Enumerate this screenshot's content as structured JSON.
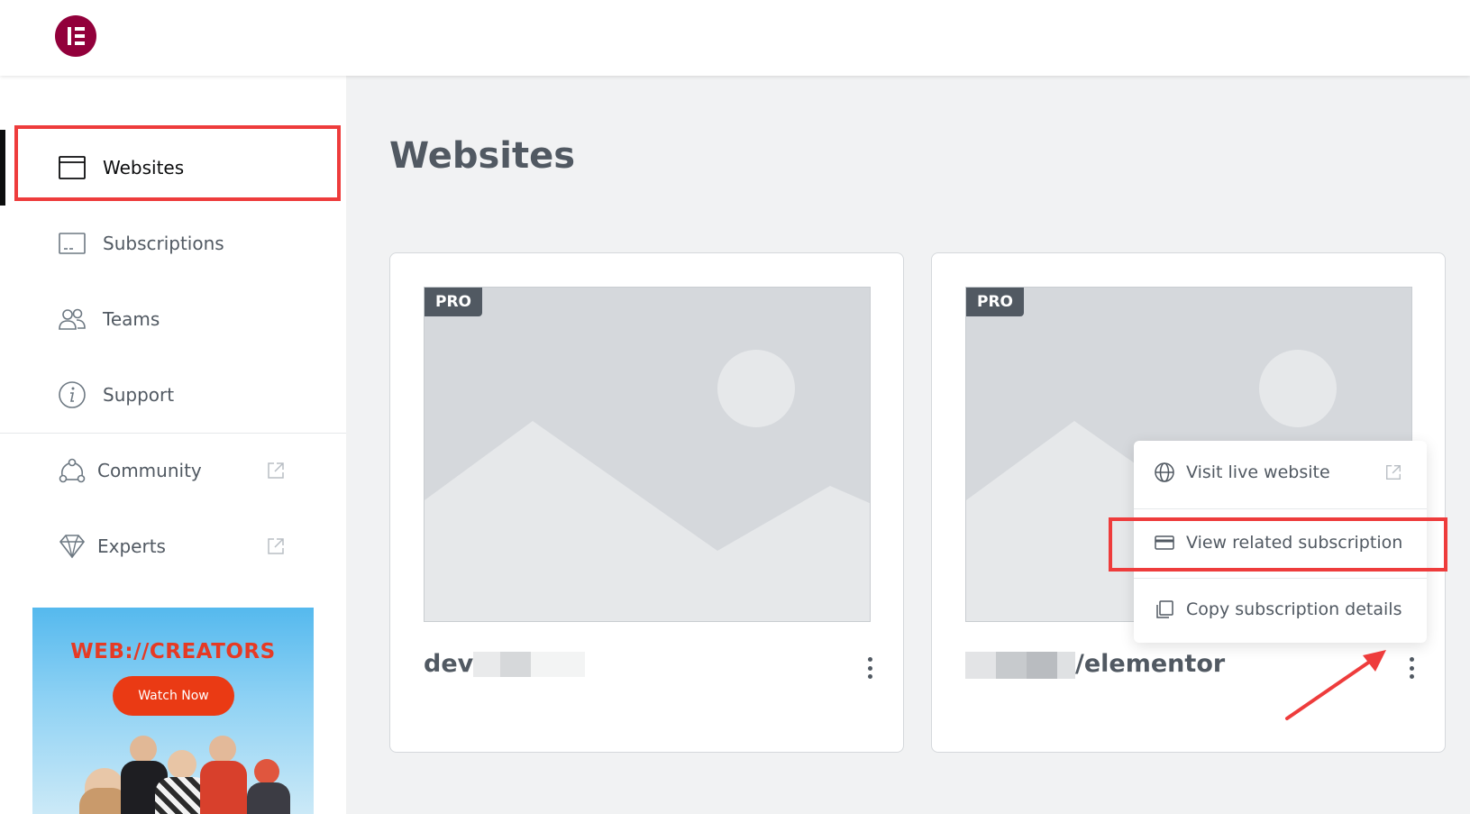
{
  "nav": {
    "items": [
      {
        "label": "Websites",
        "icon": "browser-window-icon",
        "active": true
      },
      {
        "label": "Subscriptions",
        "icon": "card-icon",
        "active": false
      },
      {
        "label": "Teams",
        "icon": "users-icon",
        "active": false
      },
      {
        "label": "Support",
        "icon": "info-circle-icon",
        "active": false
      }
    ],
    "external_items": [
      {
        "label": "Community",
        "icon": "community-icon",
        "external": true
      },
      {
        "label": "Experts",
        "icon": "diamond-icon",
        "external": true
      }
    ]
  },
  "promo": {
    "title": "WEB://CREATORS",
    "button_label": "Watch Now"
  },
  "main": {
    "title": "Websites",
    "cards": [
      {
        "badge": "PRO",
        "site_name": "dev."
      },
      {
        "badge": "PRO",
        "site_name": "/elementor"
      }
    ]
  },
  "context_menu": {
    "items": [
      {
        "label": "Visit live website",
        "icon": "globe-icon",
        "external": true
      },
      {
        "label": "View related subscription",
        "icon": "credit-card-icon",
        "external": false
      },
      {
        "label": "Copy subscription details",
        "icon": "copy-icon",
        "external": false
      }
    ]
  },
  "colors": {
    "brand": "#92003b",
    "highlight": "#ee3c3c",
    "text": "#515962",
    "promo_button": "#ea3a14"
  }
}
